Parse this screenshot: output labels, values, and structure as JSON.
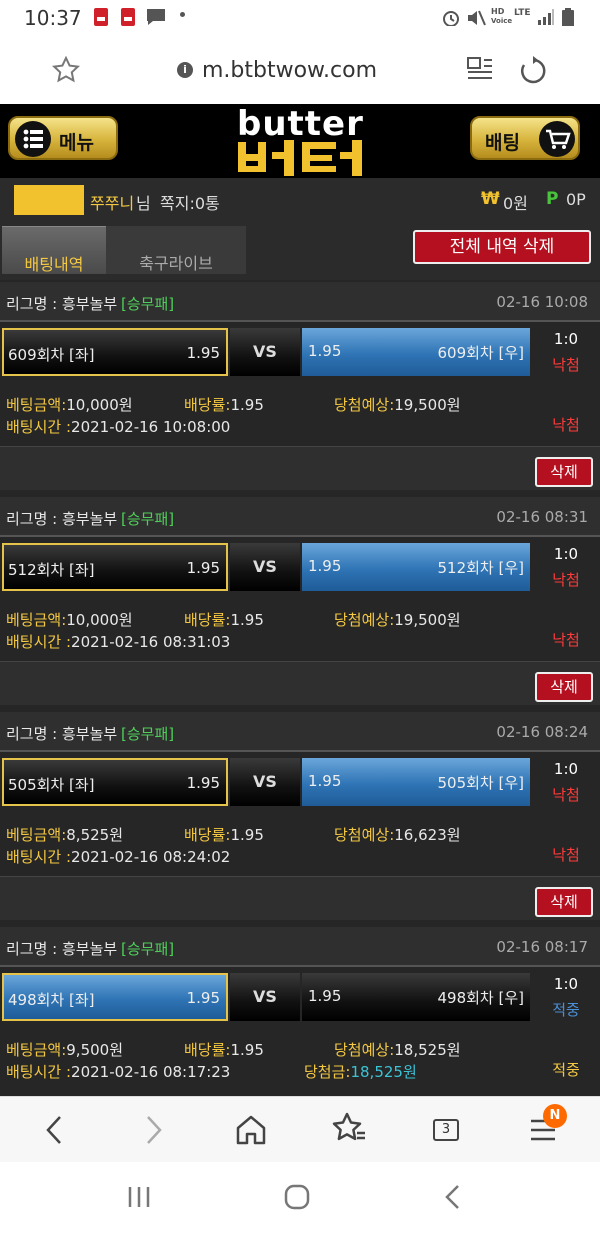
{
  "status_bar": {
    "time": "10:37",
    "network": "LTE",
    "network_sub": "Voice"
  },
  "browser": {
    "url": "m.btbtwow.com",
    "tab_count": "3",
    "notification_badge": "N"
  },
  "site": {
    "logo_text": "butter",
    "logo_korean": "버터",
    "menu_label": "메뉴",
    "bet_label": "배팅"
  },
  "user": {
    "nickname": "쭈쭈니",
    "nickname_suffix": "님",
    "messages": "쪽지:0통",
    "money_symbol": "₩",
    "money": "0원",
    "point_symbol": "P",
    "points": "0P"
  },
  "tabs": [
    {
      "label": "배팅내역",
      "active": true
    },
    {
      "label": "축구라이브",
      "active": false
    }
  ],
  "delete_all_label": "전체 내역 삭제",
  "labels": {
    "league": "리그명 :",
    "vs": "VS",
    "bet_amount": "베팅금액:",
    "odds": "배당률:",
    "expected_win": "당첨예상:",
    "bet_time": "배팅시간 :",
    "win_amount": "당첨금:",
    "delete": "삭제"
  },
  "bets": [
    {
      "league": "흥부놀부",
      "type": "[승무패]",
      "date": "02-16 10:08",
      "left_team": "609회차 [좌]",
      "left_odds": "1.95",
      "right_team": "609회차 [우]",
      "right_odds": "1.95",
      "selected": "left",
      "score": "1:0",
      "result": "낙첨",
      "amount": "10,000원",
      "odds": "1.95",
      "expected_label": "당첨예상:",
      "expected": "19,500원",
      "time": "2021-02-16 10:08:00",
      "final_result": "낙첨",
      "show_delete": true
    },
    {
      "league": "흥부놀부",
      "type": "[승무패]",
      "date": "02-16 08:31",
      "left_team": "512회차 [좌]",
      "left_odds": "1.95",
      "right_team": "512회차 [우]",
      "right_odds": "1.95",
      "selected": "left",
      "score": "1:0",
      "result": "낙첨",
      "amount": "10,000원",
      "odds": "1.95",
      "expected_label": "당첨예상:",
      "expected": "19,500원",
      "time": "2021-02-16 08:31:03",
      "final_result": "낙첨",
      "show_delete": true
    },
    {
      "league": "흥부놀부",
      "type": "[승무패]",
      "date": "02-16 08:24",
      "left_team": "505회차 [좌]",
      "left_odds": "1.95",
      "right_team": "505회차 [우]",
      "right_odds": "1.95",
      "selected": "left",
      "score": "1:0",
      "result": "낙첨",
      "amount": "8,525원",
      "odds": "1.95",
      "expected_label": "당첨예상:",
      "expected": "16,623원",
      "time": "2021-02-16 08:24:02",
      "final_result": "낙첨",
      "show_delete": true
    },
    {
      "league": "흥부놀부",
      "type": "[승무패]",
      "date": "02-16 08:17",
      "left_team": "498회차 [좌]",
      "left_odds": "1.95",
      "right_team": "498회차 [우]",
      "right_odds": "1.95",
      "selected": "left",
      "score": "1:0",
      "result": "적중",
      "amount": "9,500원",
      "odds": "1.95",
      "expected_label": "당첨예상:",
      "expected": "18,525원",
      "time": "2021-02-16 08:17:23",
      "win_amount": "18,525원",
      "final_result": "적중",
      "show_delete": false
    }
  ],
  "colors": {
    "accent_gold": "#f4c842",
    "lose_red": "#ff3a3a",
    "win_blue": "#4a8fd8",
    "type_green": "#4fcf5a",
    "selected_blue": "#2f74b5"
  }
}
